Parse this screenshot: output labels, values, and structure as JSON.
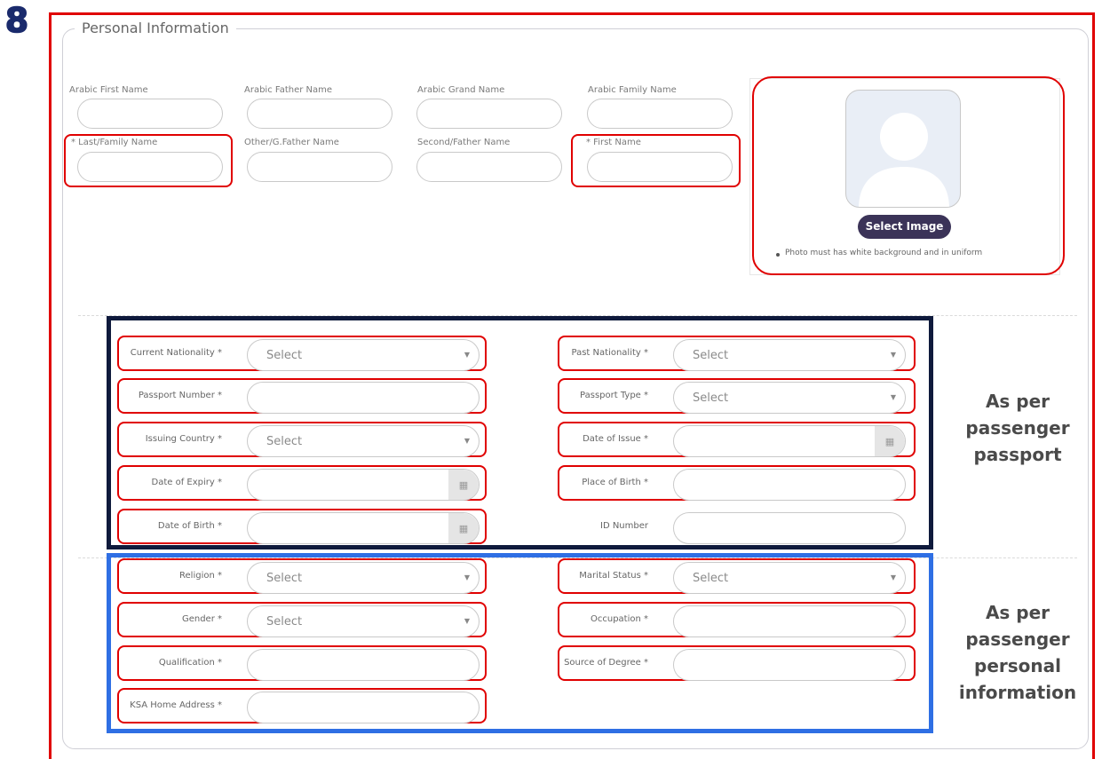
{
  "step_number": "8",
  "section": {
    "legend": "Personal Information"
  },
  "names_row1": [
    "Arabic First Name",
    "Arabic Father Name",
    "Arabic Grand Name",
    "Arabic Family Name"
  ],
  "names_row2": [
    "* Last/Family Name",
    "Other/G.Father Name",
    "Second/Father Name",
    "* First Name"
  ],
  "photo": {
    "button_label": "Select Image",
    "note": "Photo must has white background and in uniform"
  },
  "passport_fields": {
    "current_nationality": {
      "label": "Current Nationality *",
      "value": "Select"
    },
    "past_nationality": {
      "label": "Past Nationality *",
      "value": "Select"
    },
    "passport_number": {
      "label": "Passport Number *",
      "value": ""
    },
    "passport_type": {
      "label": "Passport Type *",
      "value": "Select"
    },
    "issuing_country": {
      "label": "Issuing Country *",
      "value": "Select"
    },
    "date_of_issue": {
      "label": "Date of Issue *",
      "value": ""
    },
    "date_of_expiry": {
      "label": "Date of Expiry *",
      "value": ""
    },
    "place_of_birth": {
      "label": "Place of Birth *",
      "value": ""
    },
    "date_of_birth": {
      "label": "Date of Birth *",
      "value": ""
    },
    "id_number": {
      "label": "ID Number",
      "value": ""
    }
  },
  "personal_fields": {
    "religion": {
      "label": "Religion *",
      "value": "Select"
    },
    "marital_status": {
      "label": "Marital Status *",
      "value": "Select"
    },
    "gender": {
      "label": "Gender *",
      "value": "Select"
    },
    "occupation": {
      "label": "Occupation *",
      "value": ""
    },
    "qualification": {
      "label": "Qualification *",
      "value": ""
    },
    "source_of_degree": {
      "label": "Source of Degree *",
      "value": ""
    },
    "ksa_home_address": {
      "label": "KSA Home Address *",
      "value": ""
    }
  },
  "annotations": {
    "passport_note": [
      "As per",
      "passenger",
      "passport"
    ],
    "personal_note": [
      "As per",
      "passenger",
      "personal",
      "information"
    ]
  },
  "icons": {
    "dropdown": "caret-down-icon",
    "calendar": "calendar-icon",
    "avatar": "avatar-placeholder-icon"
  },
  "colors": {
    "highlight_red": "#e00000",
    "passport_box": "#0f1a3c",
    "personal_box": "#2f6fe4",
    "button_bg": "#3b3358"
  }
}
